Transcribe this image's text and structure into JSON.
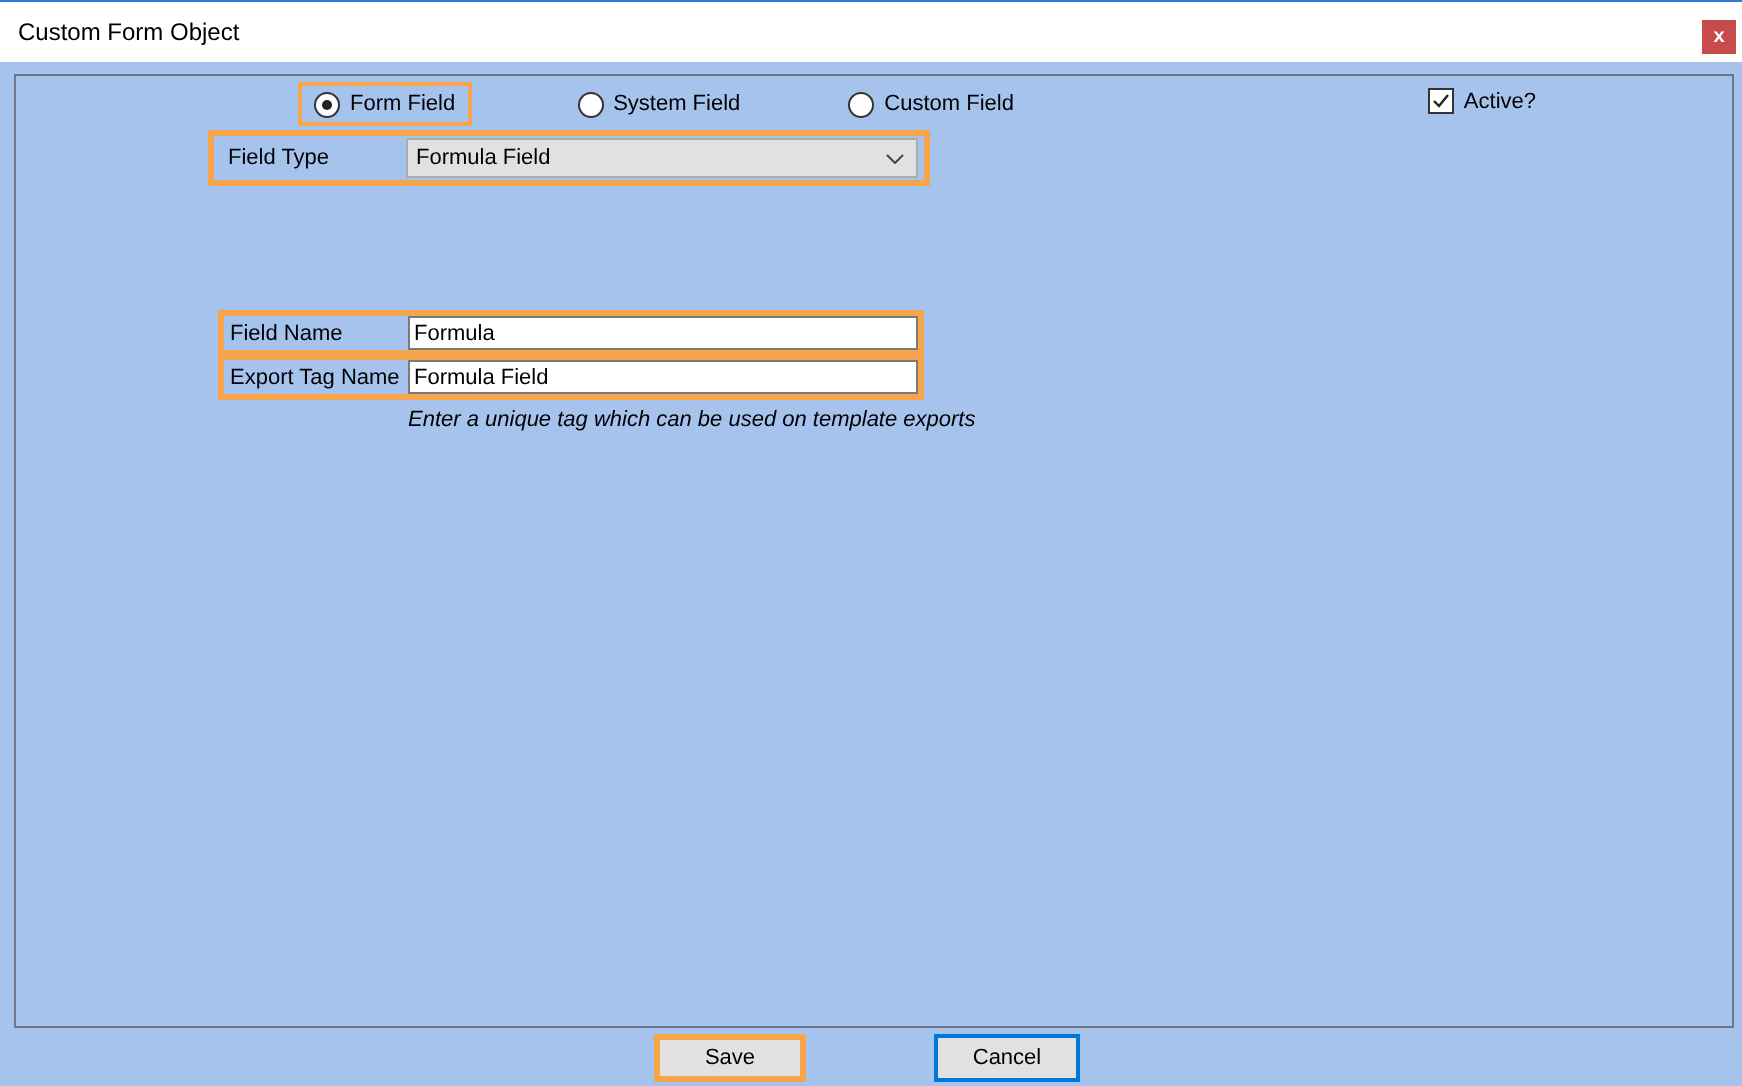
{
  "window": {
    "title": "Custom Form Object",
    "close": "x"
  },
  "source_options": [
    {
      "label": "Form Field",
      "selected": true,
      "highlighted": true
    },
    {
      "label": "System Field",
      "selected": false,
      "highlighted": false
    },
    {
      "label": "Custom Field",
      "selected": false,
      "highlighted": false
    }
  ],
  "active": {
    "label": "Active?",
    "checked": true
  },
  "field_type": {
    "label": "Field Type",
    "value": "Formula Field",
    "highlighted": true
  },
  "fields": [
    {
      "label": "Field Name",
      "value": "Formula",
      "highlighted": true
    },
    {
      "label": "Export Tag Name",
      "value": "Formula Field",
      "highlighted": true
    }
  ],
  "hint": "Enter a unique tag which can be used on template exports",
  "buttons": [
    {
      "label": "Save",
      "highlighted": true,
      "focused": false
    },
    {
      "label": "Cancel",
      "highlighted": false,
      "focused": true
    }
  ]
}
